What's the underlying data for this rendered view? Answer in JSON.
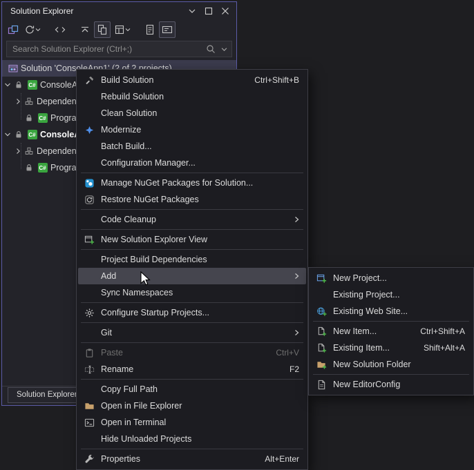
{
  "colors": {
    "window_border": "#5c5ca8",
    "menu_background": "#1c1c21",
    "menu_highlight": "#45454e",
    "nuget_blue": "#2491cf",
    "add_new_green": "#4cb648",
    "csharp_green": "#3aa53f",
    "folder_tan": "#c7a06b",
    "selected_row": "#3b3b4d"
  },
  "window": {
    "title": "Solution Explorer",
    "search_placeholder": "Search Solution Explorer (Ctrl+;)",
    "bottom_tab": "Solution Explorer"
  },
  "toolbar": {
    "icons": [
      "switch-views",
      "pending-changes-filter",
      "back-forward-navigation",
      "collapse-all",
      "sync-with-active-document",
      "solution-views",
      "show-all-files",
      "preview-selected-items"
    ]
  },
  "tree": {
    "items": [
      {
        "label": "Solution 'ConsoleApp1' (2 of 2 projects)",
        "type": "solution",
        "selected": true
      },
      {
        "label": "ConsoleApp1",
        "type": "project",
        "expanded": true
      },
      {
        "label": "Dependencies",
        "type": "dependencies",
        "expanded": false
      },
      {
        "label": "Program.cs",
        "type": "file"
      },
      {
        "label": "ConsoleApp2",
        "type": "project",
        "expanded": true,
        "bold": true
      },
      {
        "label": "Dependencies",
        "type": "dependencies",
        "expanded": false
      },
      {
        "label": "Program.cs",
        "type": "file"
      }
    ]
  },
  "context_menu": {
    "items": [
      {
        "label": "Build Solution",
        "shortcut": "Ctrl+Shift+B",
        "icon": "build-icon"
      },
      {
        "label": "Rebuild Solution"
      },
      {
        "label": "Clean Solution"
      },
      {
        "label": "Modernize",
        "icon": "modernize-icon"
      },
      {
        "label": "Batch Build..."
      },
      {
        "label": "Configuration Manager..."
      },
      {
        "label": "Manage NuGet Packages for Solution...",
        "icon": "nuget-icon"
      },
      {
        "label": "Restore NuGet Packages",
        "icon": "nuget-restore-icon"
      },
      {
        "label": "Code Cleanup",
        "submenu": true
      },
      {
        "label": "New Solution Explorer View",
        "icon": "new-solution-explorer-view-icon"
      },
      {
        "label": "Project Build Dependencies"
      },
      {
        "label": "Add",
        "submenu": true,
        "highlighted": true
      },
      {
        "label": "Sync Namespaces"
      },
      {
        "label": "Configure Startup Projects...",
        "icon": "gear-icon"
      },
      {
        "label": "Git",
        "submenu": true
      },
      {
        "label": "Paste",
        "shortcut": "Ctrl+V",
        "disabled": true,
        "icon": "clipboard-icon"
      },
      {
        "label": "Rename",
        "shortcut": "F2",
        "icon": "rename-icon"
      },
      {
        "label": "Copy Full Path"
      },
      {
        "label": "Open in File Explorer",
        "icon": "folder-icon"
      },
      {
        "label": "Open in Terminal",
        "icon": "terminal-icon"
      },
      {
        "label": "Hide Unloaded Projects"
      },
      {
        "label": "Properties",
        "shortcut": "Alt+Enter",
        "icon": "wrench-icon"
      }
    ]
  },
  "add_submenu": {
    "items": [
      {
        "label": "New Project...",
        "icon": "new-project-icon"
      },
      {
        "label": "Existing Project..."
      },
      {
        "label": "Existing Web Site...",
        "icon": "web-site-icon"
      },
      {
        "label": "New Item...",
        "shortcut": "Ctrl+Shift+A",
        "icon": "new-item-icon"
      },
      {
        "label": "Existing Item...",
        "shortcut": "Shift+Alt+A",
        "icon": "existing-item-icon"
      },
      {
        "label": "New Solution Folder",
        "icon": "new-solution-folder-icon"
      },
      {
        "label": "New EditorConfig",
        "icon": "editorconfig-icon"
      }
    ]
  }
}
